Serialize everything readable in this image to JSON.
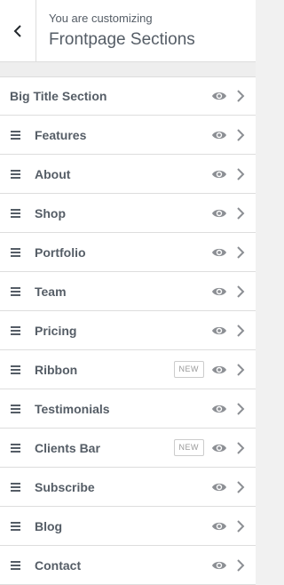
{
  "header": {
    "subtitle": "You are customizing",
    "title": "Frontpage Sections",
    "back_icon": "chevron-left-icon"
  },
  "sections": [
    {
      "label": "Big Title Section",
      "draggable": false,
      "badge": ""
    },
    {
      "label": "Features",
      "draggable": true,
      "badge": ""
    },
    {
      "label": "About",
      "draggable": true,
      "badge": ""
    },
    {
      "label": "Shop",
      "draggable": true,
      "badge": ""
    },
    {
      "label": "Portfolio",
      "draggable": true,
      "badge": ""
    },
    {
      "label": "Team",
      "draggable": true,
      "badge": ""
    },
    {
      "label": "Pricing",
      "draggable": true,
      "badge": ""
    },
    {
      "label": "Ribbon",
      "draggable": true,
      "badge": "NEW"
    },
    {
      "label": "Testimonials",
      "draggable": true,
      "badge": ""
    },
    {
      "label": "Clients Bar",
      "draggable": true,
      "badge": "NEW"
    },
    {
      "label": "Subscribe",
      "draggable": true,
      "badge": ""
    },
    {
      "label": "Blog",
      "draggable": true,
      "badge": ""
    },
    {
      "label": "Contact",
      "draggable": true,
      "badge": ""
    }
  ],
  "icons": {
    "drag": "drag-handle-icon",
    "visibility": "eye-icon",
    "open": "chevron-right-icon"
  },
  "colors": {
    "text": "#555d66",
    "border": "#dddddd",
    "background": "#f1f1f1",
    "icon": "#8c8f94"
  }
}
